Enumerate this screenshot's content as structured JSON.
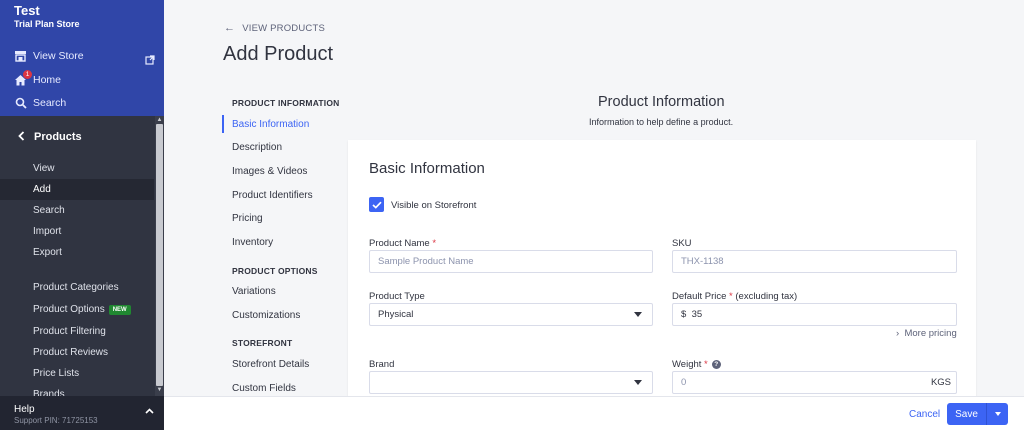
{
  "store": {
    "name": "Test",
    "plan": "Trial Plan Store"
  },
  "topnav": {
    "view_store": "View Store",
    "home": "Home",
    "home_badge": "1",
    "search": "Search"
  },
  "sidebar": {
    "section": "Products",
    "items": [
      {
        "label": "View"
      },
      {
        "label": "Add",
        "active": true
      },
      {
        "label": "Search"
      },
      {
        "label": "Import"
      },
      {
        "label": "Export"
      },
      {
        "label": "Product Categories"
      },
      {
        "label": "Product Options",
        "badge": "NEW"
      },
      {
        "label": "Product Filtering"
      },
      {
        "label": "Product Reviews"
      },
      {
        "label": "Price Lists"
      },
      {
        "label": "Brands"
      }
    ],
    "help_title": "Help",
    "support_pin": "Support PIN: 71725153"
  },
  "header": {
    "back_label": "VIEW PRODUCTS",
    "title": "Add Product"
  },
  "side_nav": {
    "groups": [
      {
        "title": "PRODUCT INFORMATION",
        "items": [
          "Basic Information",
          "Description",
          "Images & Videos",
          "Product Identifiers",
          "Pricing",
          "Inventory"
        ]
      },
      {
        "title": "PRODUCT OPTIONS",
        "items": [
          "Variations",
          "Customizations"
        ]
      },
      {
        "title": "STOREFRONT",
        "items": [
          "Storefront Details",
          "Custom Fields"
        ]
      }
    ]
  },
  "section": {
    "title": "Product Information",
    "subtitle": "Information to help define a product."
  },
  "card": {
    "title": "Basic Information",
    "visible_label": "Visible on Storefront",
    "visible_checked": true,
    "product_name_label": "Product Name",
    "product_name_placeholder": "Sample Product Name",
    "sku_label": "SKU",
    "sku_placeholder": "THX-1138",
    "product_type_label": "Product Type",
    "product_type_value": "Physical",
    "default_price_label": "Default Price",
    "default_price_suffix": "(excluding tax)",
    "currency_symbol": "$",
    "default_price_value": "35",
    "more_pricing": "More pricing",
    "brand_label": "Brand",
    "brand_value": "",
    "weight_label": "Weight",
    "weight_placeholder": "0",
    "weight_unit": "KGS",
    "required_mark": "*"
  },
  "footer": {
    "cancel_label": "Cancel",
    "save_label": "Save"
  },
  "colors": {
    "accent": "#3c64f4",
    "sidebar": "#303441",
    "sidebar_top": "#3046a8",
    "required": "#db3643"
  }
}
